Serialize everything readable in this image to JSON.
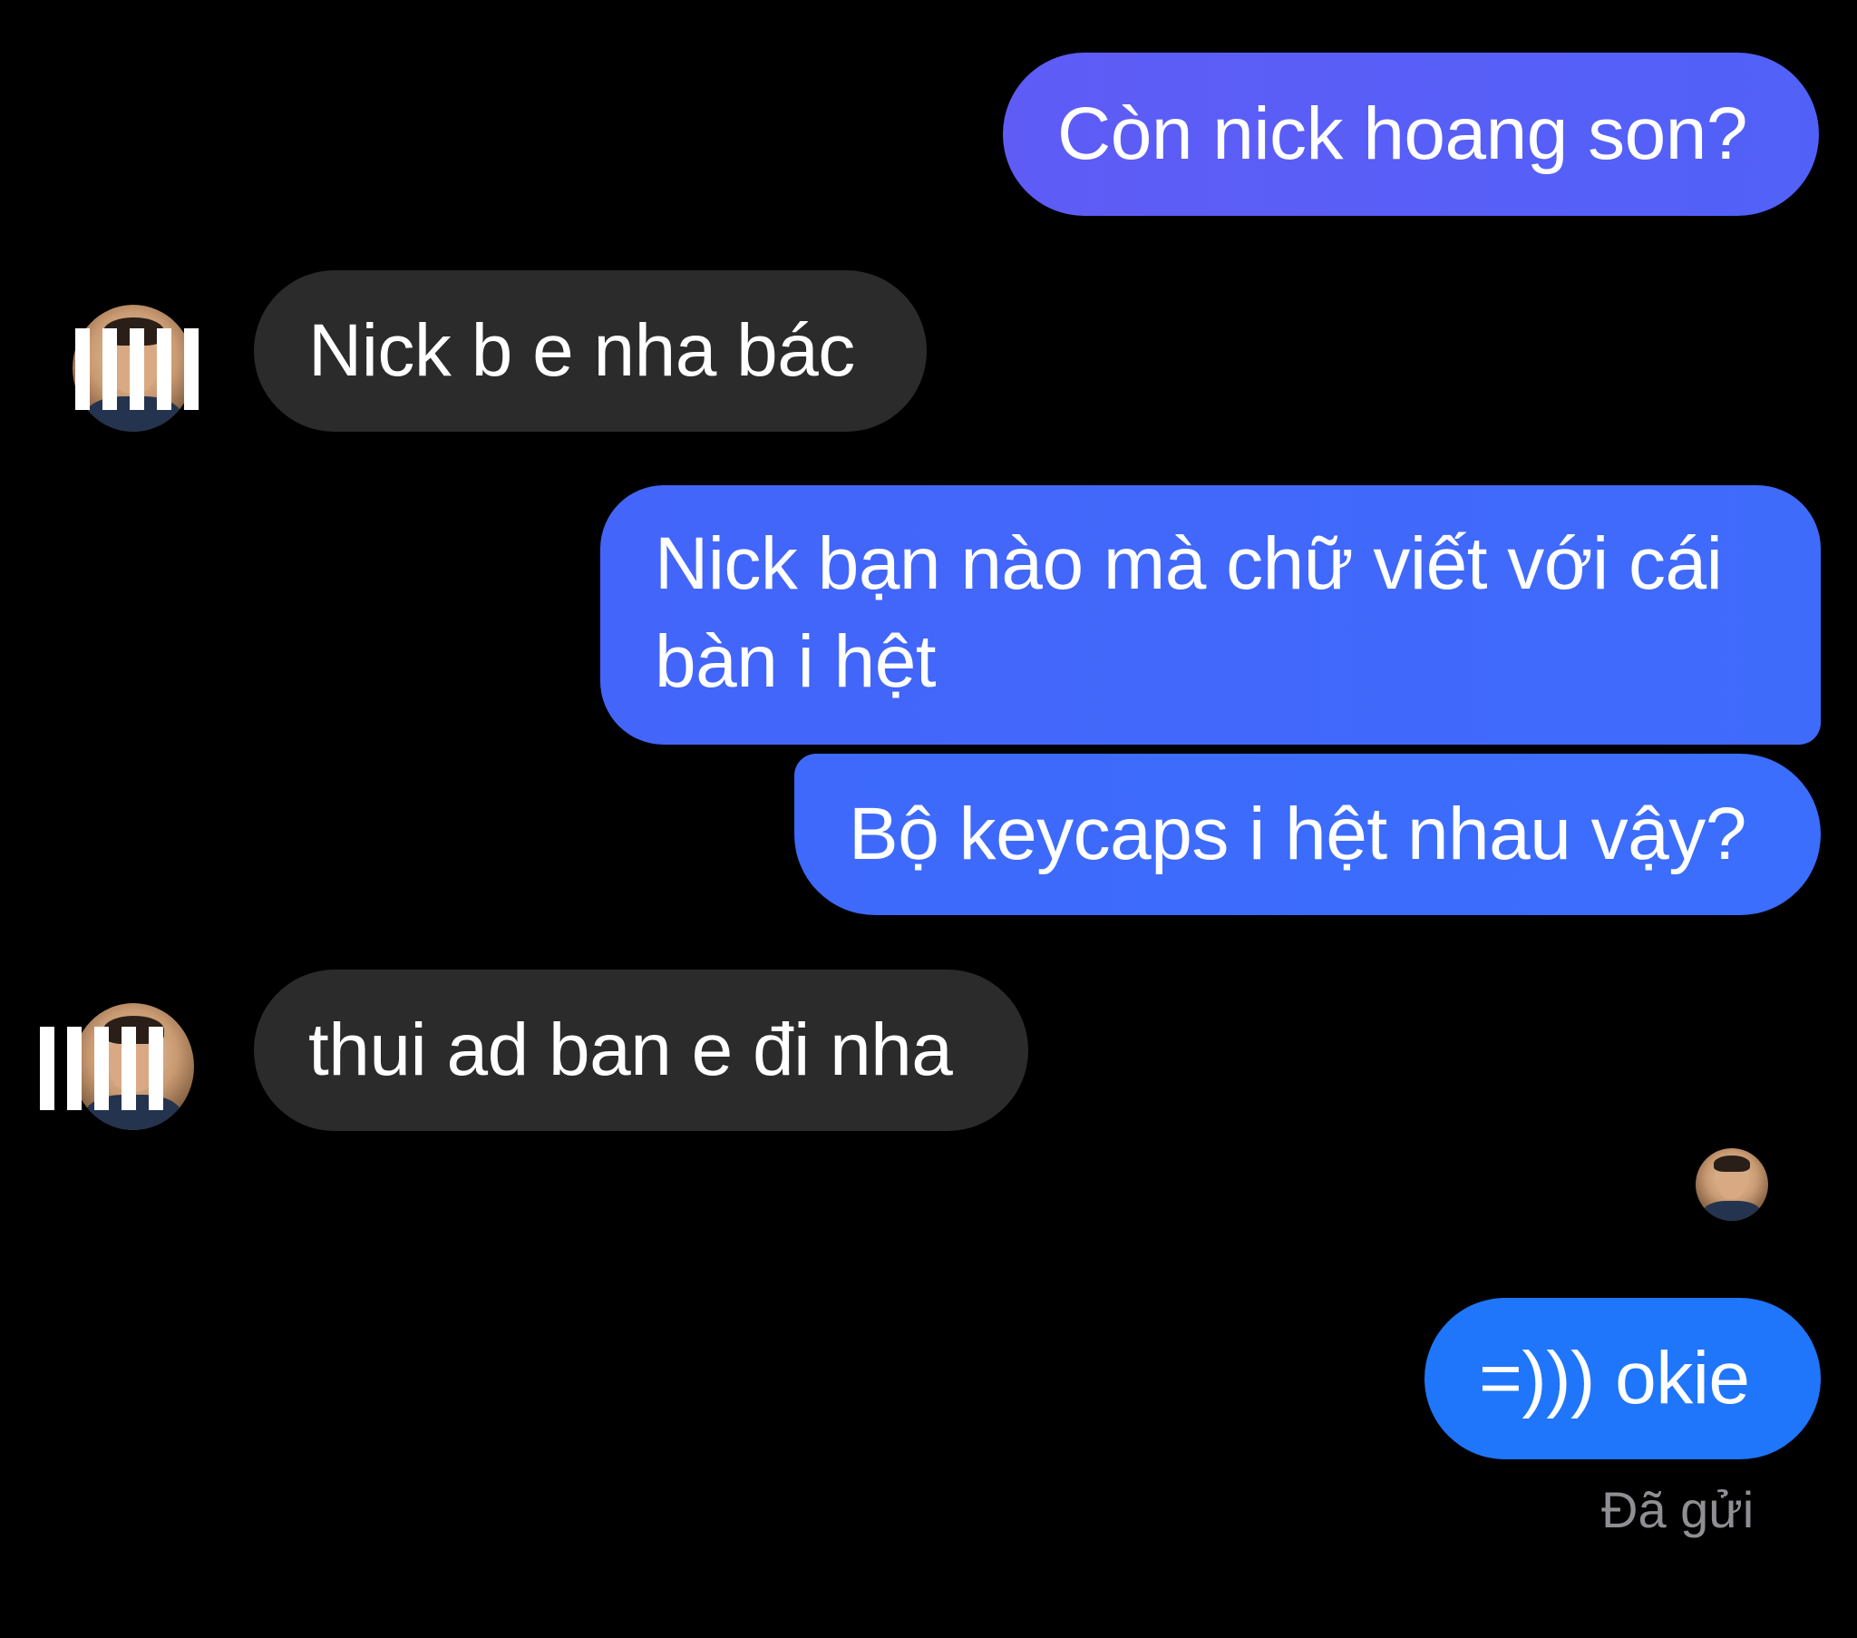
{
  "conversation": {
    "messages": [
      {
        "side": "sent",
        "text": "Còn nick hoang son?"
      },
      {
        "side": "received",
        "text": "Nick b e nha bác"
      },
      {
        "side": "sent",
        "lines": [
          "Nick bạn nào mà chữ viết với cái",
          "bàn i hệt"
        ]
      },
      {
        "side": "sent",
        "text": "Bộ keycaps i hệt nhau vậy?"
      },
      {
        "side": "received",
        "text": "thui ad ban e đi nha"
      },
      {
        "side": "sent",
        "text": "=))) okie"
      }
    ],
    "status_text": "Đã gửi"
  },
  "colors": {
    "background": "#000000",
    "sent_bubble_top": "#5f5cf6",
    "sent_bubble_mid": "#4365fa",
    "sent_bubble_bottom": "#1f76fb",
    "received_bubble": "#2b2b2b",
    "status_text": "#8e8e93"
  },
  "icons": {
    "contact_avatar": "avatar-icon",
    "seen_indicator": "seen-avatar-icon"
  }
}
